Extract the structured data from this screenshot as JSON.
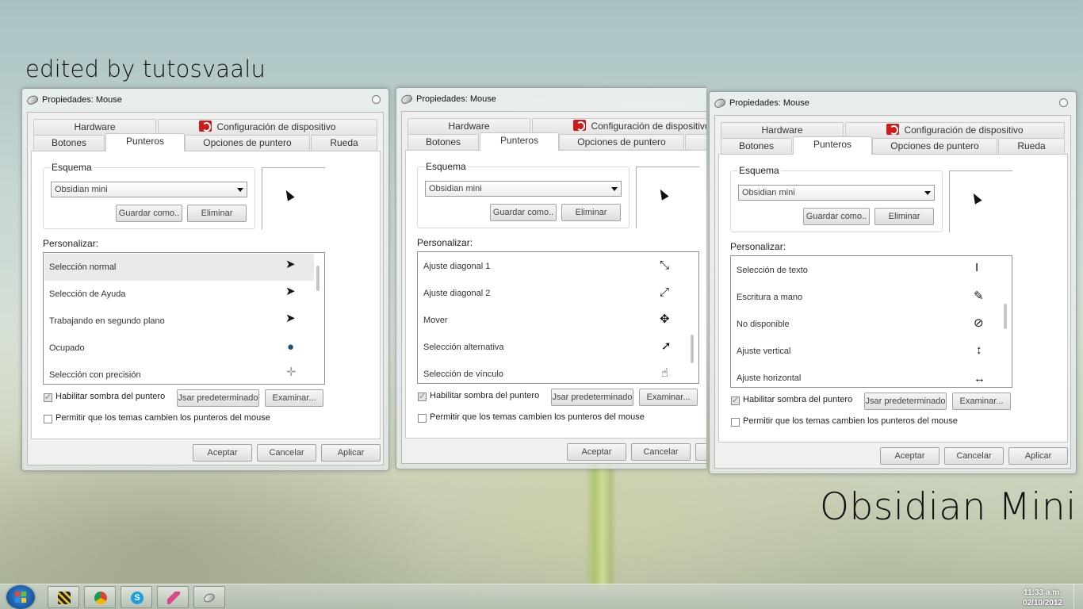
{
  "captions": {
    "top": "edited by tutosvaalu",
    "bottom": "Obsidian Mini"
  },
  "window": {
    "title": "Propiedades: Mouse",
    "tabs_row1": [
      "Hardware",
      "Configuración de dispositivo"
    ],
    "tabs_row2": [
      "Botones",
      "Punteros",
      "Opciones de puntero",
      "Rueda"
    ],
    "active_tab": "Punteros",
    "scheme_label": "Esquema",
    "scheme_value": "Obsidian mini",
    "save_as": "Guardar como..",
    "delete": "Eliminar",
    "customize_label": "Personalizar:",
    "shadow_label": "Habilitar sombra del puntero",
    "use_default": "Jsar predeterminado",
    "browse": "Examinar...",
    "themes_label": "Permitir que los temas cambien los punteros del mouse",
    "ok": "Aceptar",
    "cancel": "Cancelar",
    "apply": "Aplicar"
  },
  "windows": [
    {
      "items": [
        {
          "label": "Selección normal",
          "icon": "arrow-cursor-icon",
          "selected": true
        },
        {
          "label": "Selección de Ayuda",
          "icon": "help-cursor-icon"
        },
        {
          "label": "Trabajando en segundo plano",
          "icon": "working-cursor-icon"
        },
        {
          "label": "Ocupado",
          "icon": "busy-cursor-icon"
        },
        {
          "label": "Selección con precisión",
          "icon": "crosshair-cursor-icon"
        }
      ]
    },
    {
      "items": [
        {
          "label": "Ajuste diagonal 1",
          "icon": "diagonal-resize-1-icon"
        },
        {
          "label": "Ajuste diagonal 2",
          "icon": "diagonal-resize-2-icon"
        },
        {
          "label": "Mover",
          "icon": "move-cursor-icon"
        },
        {
          "label": "Selección alternativa",
          "icon": "alternate-select-icon"
        },
        {
          "label": "Selección de vínculo",
          "icon": "link-hand-icon"
        }
      ]
    },
    {
      "items": [
        {
          "label": "Selección de texto",
          "icon": "text-beam-icon"
        },
        {
          "label": "Escritura a mano",
          "icon": "pen-cursor-icon"
        },
        {
          "label": "No disponible",
          "icon": "unavailable-cursor-icon"
        },
        {
          "label": "Ajuste vertical",
          "icon": "vertical-resize-icon"
        },
        {
          "label": "Ajuste horizontal",
          "icon": "horizontal-resize-icon"
        }
      ]
    }
  ],
  "taskbar": {
    "apps": [
      "taskbar-app-striped-icon",
      "chrome-icon",
      "skype-icon",
      "feather-icon",
      "mouse-icon"
    ],
    "time": "11:33 a.m.",
    "date": "02/10/2012"
  }
}
